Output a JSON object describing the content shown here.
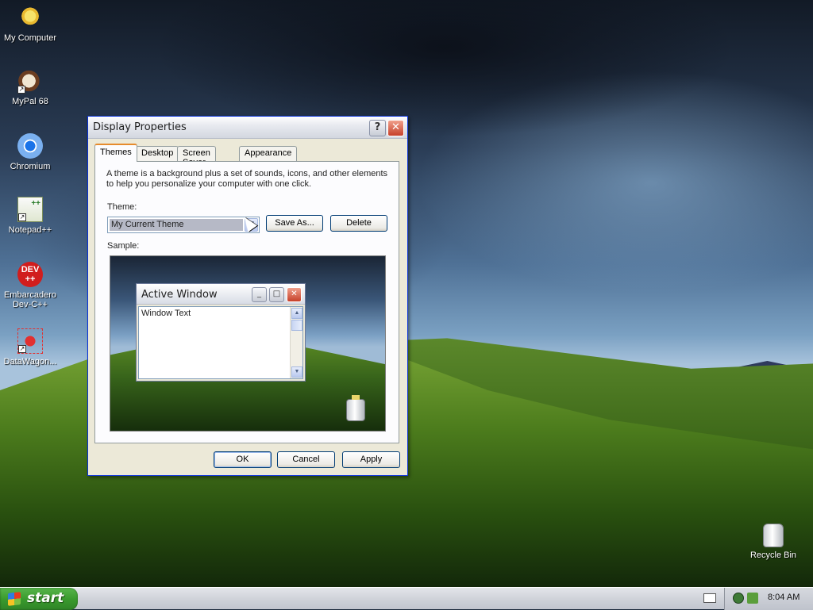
{
  "desktop": {
    "icons": [
      {
        "label": "My Computer",
        "icon": "my-computer-icon"
      },
      {
        "label": "MyPal 68",
        "icon": "mypal-icon"
      },
      {
        "label": "Chromium",
        "icon": "chromium-icon"
      },
      {
        "label": "Notepad++",
        "icon": "notepad-plus-plus-icon"
      },
      {
        "label": "Embarcadero Dev-C++",
        "icon": "dev-cpp-icon",
        "badge": "DEV ++"
      },
      {
        "label": "DataWagon...",
        "icon": "datawagon-icon"
      },
      {
        "label": "Recycle Bin",
        "icon": "recycle-bin-icon"
      }
    ]
  },
  "dialog": {
    "title": "Display Properties",
    "help_glyph": "?",
    "close_glyph": "✕",
    "tabs": [
      "Themes",
      "Desktop",
      "Screen Saver",
      "Appearance"
    ],
    "active_tab": "Themes",
    "description": "A theme is a background plus a set of sounds, icons, and other elements to help you personalize your computer with one click.",
    "theme_label": "Theme:",
    "theme_value": "My Current Theme",
    "save_as_label": "Save As...",
    "delete_label": "Delete",
    "sample_label": "Sample:",
    "sample": {
      "window_title": "Active Window",
      "window_text": "Window Text",
      "minimize_glyph": "_",
      "maximize_glyph": "□",
      "close_glyph": "✕"
    },
    "ok_label": "OK",
    "cancel_label": "Cancel",
    "apply_label": "Apply"
  },
  "taskbar": {
    "start_label": "start",
    "clock": "8:04 AM"
  },
  "colors": {
    "xp_blue": "#0831d9",
    "start_green": "#3a9b2e",
    "tab_active_accent": "#e68b2c"
  }
}
